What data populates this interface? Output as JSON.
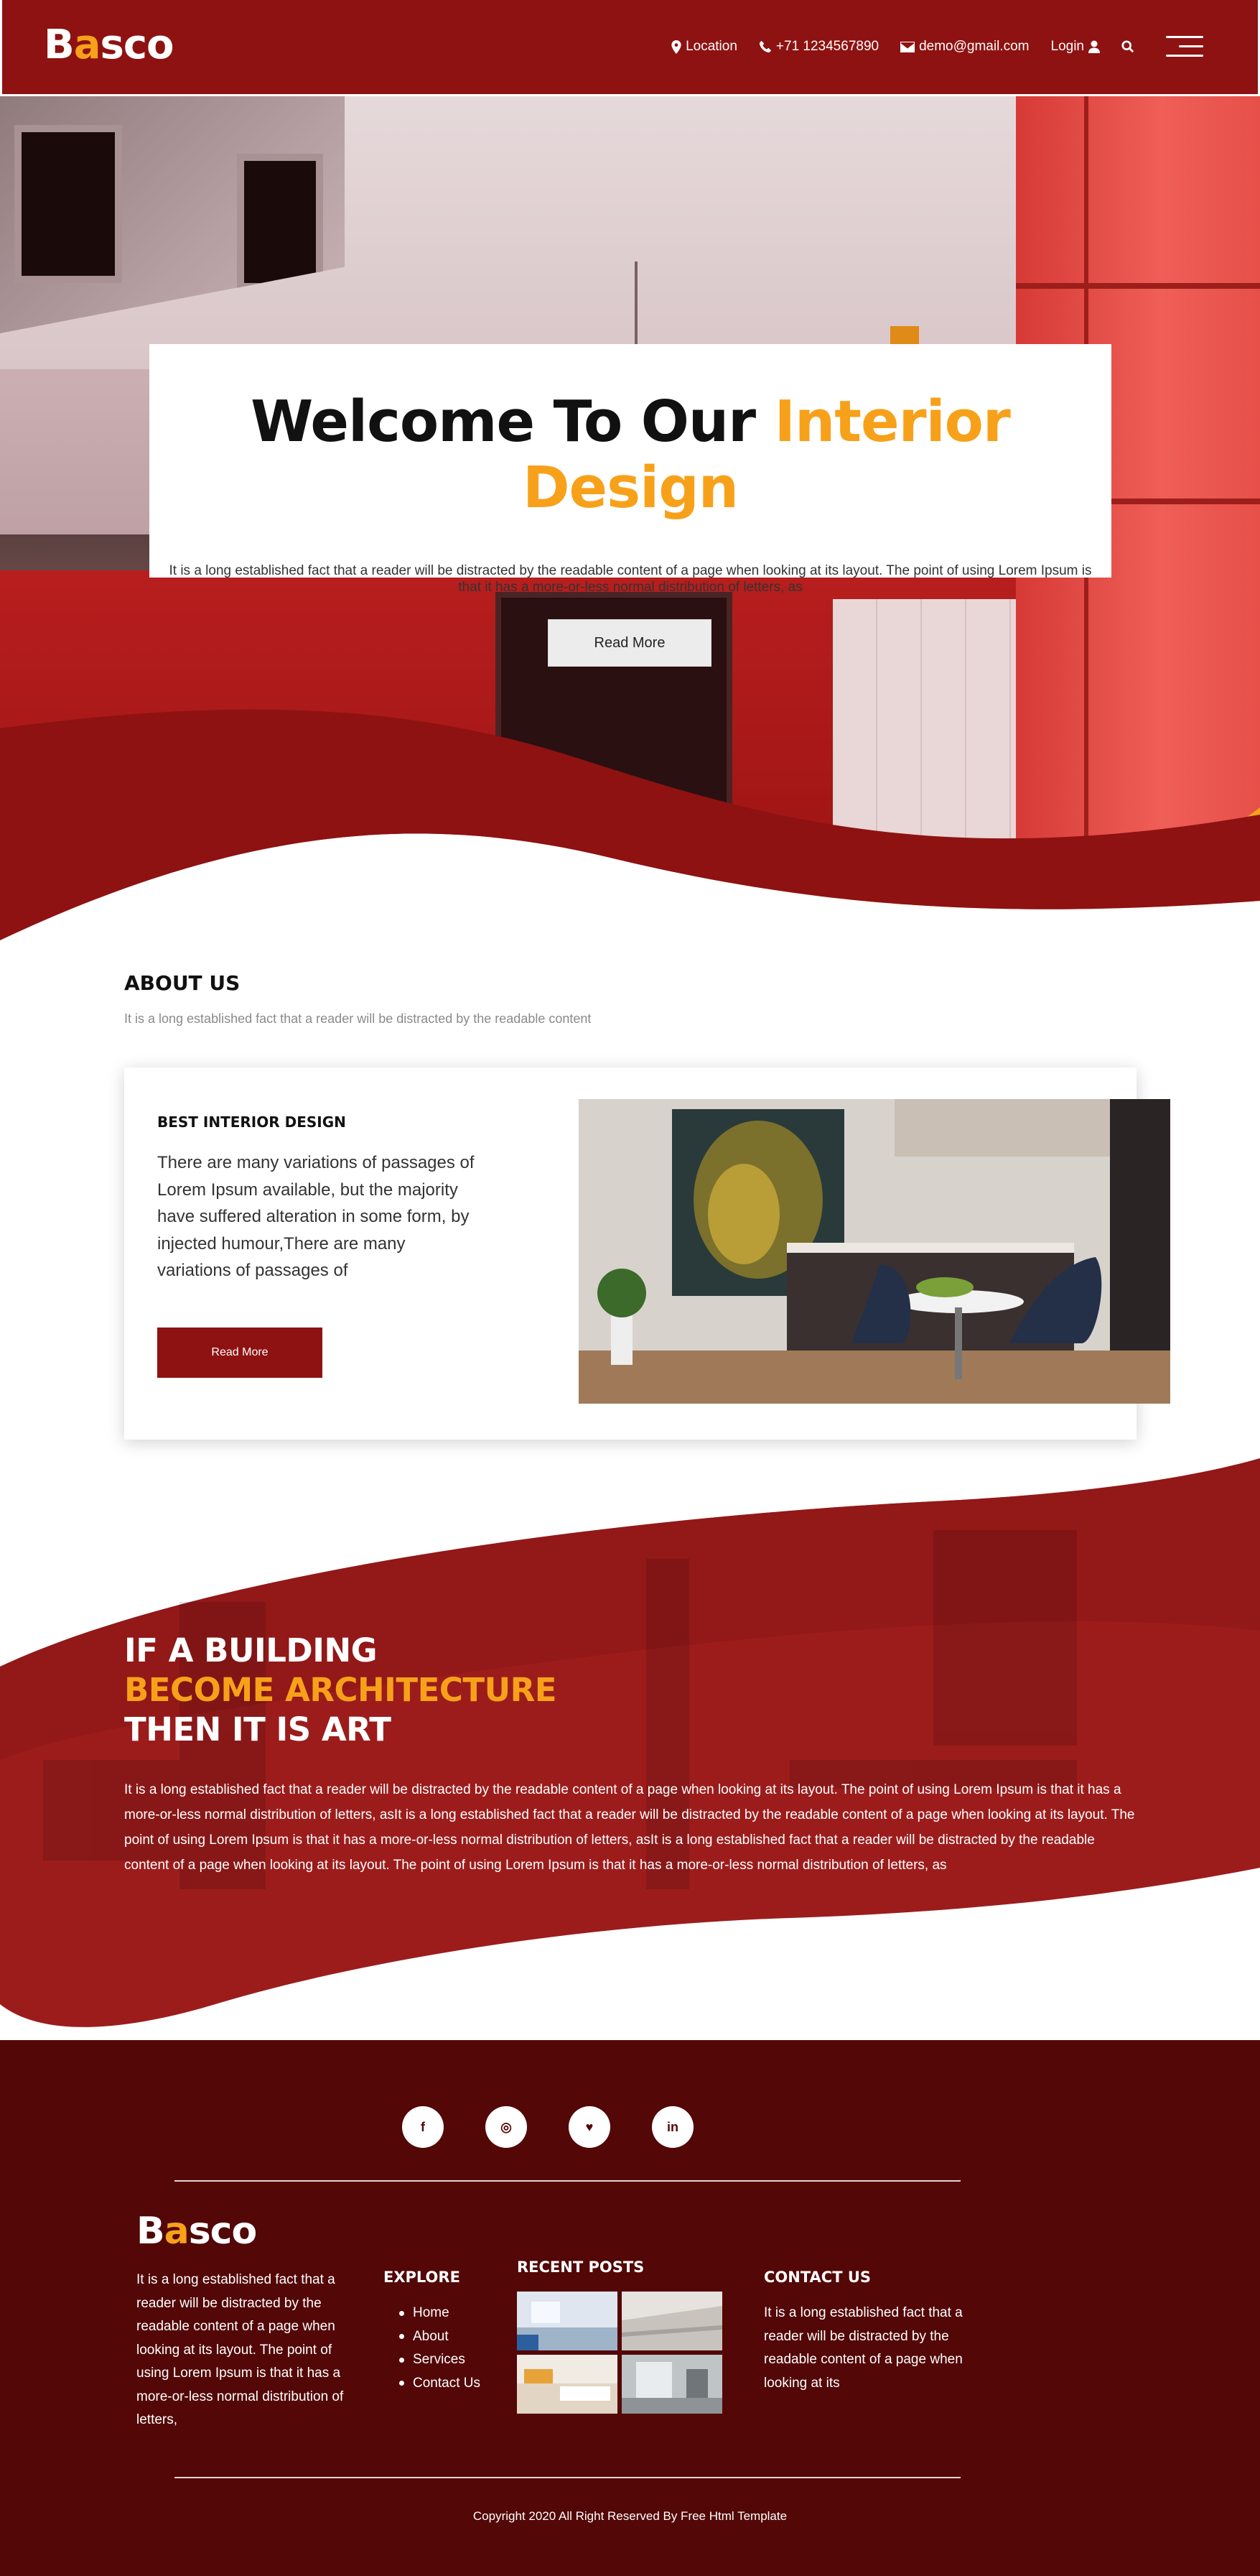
{
  "header": {
    "logo_first": "B",
    "logo_accent": "a",
    "logo_rest": "sco",
    "nav": {
      "location": "Location",
      "phone": "+71 1234567890",
      "email": "demo@gmail.com",
      "login": "Login"
    }
  },
  "hero": {
    "title_main": "Welcome To Our ",
    "title_accent": "Interior Design",
    "text": "It is a long established fact that a reader will be distracted by the readable content of a page when looking at its layout. The point of using Lorem Ipsum is that it has a more-or-less normal distribution of letters, as",
    "button": "Read More"
  },
  "about": {
    "title": "ABOUT US",
    "subtitle": "It is a long established fact that a reader will be distracted by the readable content",
    "card_title": "BEST INTERIOR DESIGN",
    "card_text": "There are many variations of passages of Lorem Ipsum available, but the majority have suffered alteration in some form, by injected humour,There are many variations of passages of",
    "card_button": "Read More"
  },
  "architecture": {
    "line1": "IF A BUILDING",
    "line2": "BECOME ARCHITECTURE",
    "line3": "THEN IT IS ART",
    "text": "It is a long established fact that a reader will be distracted by the readable content of a page when looking at its layout. The point of using Lorem Ipsum is that it has a more-or-less normal distribution of letters, asIt is a long established fact that a reader will be distracted by the readable content of a page when looking at its layout. The point of using Lorem Ipsum is that it has a more-or-less normal distribution of letters, asIt is a long established fact that a reader will be distracted by the readable content of a page when looking at its layout. The point of using Lorem Ipsum is that it has a more-or-less normal distribution of letters, as"
  },
  "footer": {
    "socials": [
      {
        "icon": "facebook-icon",
        "glyph": "f"
      },
      {
        "icon": "instagram-icon",
        "glyph": "◎"
      },
      {
        "icon": "twitter-icon",
        "glyph": "♥"
      },
      {
        "icon": "linkedin-icon",
        "glyph": "in"
      }
    ],
    "logo_first": "B",
    "logo_accent": "a",
    "logo_rest": "sco",
    "about_text": "It is a long established fact that a reader will be distracted by the readable content of a page when looking at its layout. The point of using Lorem Ipsum is that it has a more-or-less normal distribution of letters,",
    "explore_title": "EXPLORE",
    "explore_links": [
      "Home",
      "About",
      "Services",
      "Contact Us"
    ],
    "posts_title": "RECENT POSTS",
    "contact_title": "CONTACT US",
    "contact_text": "It is a long established fact that a reader will be distracted by the readable content of a page when looking at its",
    "copyright": "Copyright 2020 All Right Reserved By Free Html Template"
  },
  "colors": {
    "brand_red": "#8e1212",
    "footer_bg": "#530707",
    "accent_orange": "#f7a11a"
  }
}
